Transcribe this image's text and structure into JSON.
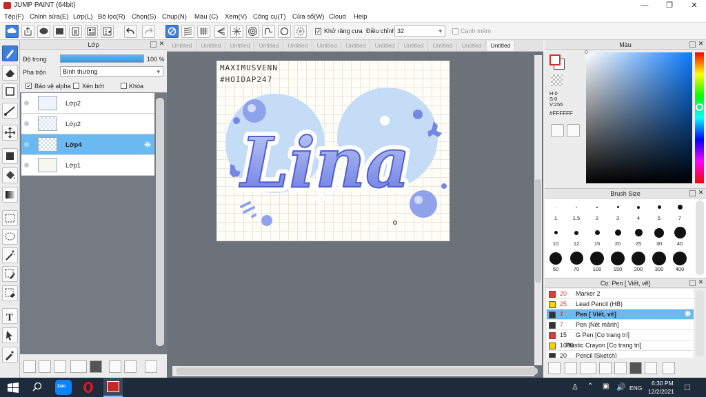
{
  "window": {
    "title": "JUMP PAINT (64bit)"
  },
  "menu": [
    "Tệp(F)",
    "Chỉnh sửa(E)",
    "Lớp(L)",
    "Bộ lọc(R)",
    "Chọn(S)",
    "Chụp(N)",
    "Màu (C)",
    "Xem(V)",
    "Công cụ(T)",
    "Cửa sổ(W)",
    "Cloud",
    "Help"
  ],
  "toolbar": {
    "antialias_label": "Khử răng cưa",
    "adjust_label": "Điều chỉnh",
    "adjust_value": "32",
    "snap_label": "Cạnh mềm"
  },
  "layer_panel": {
    "title": "Lớp",
    "opacity_label": "Độ trong",
    "opacity_value": "100 %",
    "opacity_level": 1.0,
    "blend_label": "Pha trộn",
    "blend_value": "Bình thường",
    "protect_alpha": "Bảo vệ alpha",
    "clip": "Xén bớt",
    "lock": "Khóa",
    "layers": [
      {
        "name": "Lớp2",
        "selected": false
      },
      {
        "name": "Lớp2",
        "selected": false
      },
      {
        "name": "Lớp4",
        "selected": true
      },
      {
        "name": "Lớp1",
        "selected": false
      }
    ]
  },
  "tabs": [
    "Untitled",
    "Untitled",
    "Untitled",
    "Untitled",
    "Untitled",
    "Untitled",
    "Untitled",
    "Untitled",
    "Untitled",
    "Untitled",
    "Untitled",
    "Untitled"
  ],
  "artwork": {
    "signature_line1": "MAXIMUSVENN",
    "signature_line2": "#HOIDAP247",
    "lettering": "Lina"
  },
  "color_panel": {
    "title": "Màu",
    "h": "H:0",
    "s": "S:0",
    "v": "V:255",
    "hex": "#FFFFFF"
  },
  "brush_size_panel": {
    "title": "Brush Size",
    "sizes": [
      "1",
      "1.5",
      "2",
      "3",
      "4",
      "5",
      "7",
      "10",
      "12",
      "15",
      "20",
      "25",
      "30",
      "40",
      "50",
      "70",
      "100",
      "150",
      "200",
      "300",
      "400"
    ]
  },
  "brush_list_panel": {
    "title": "Cọ: Pen [ Viết, vẽ]",
    "brushes": [
      {
        "size": "20",
        "name": "Marker 2",
        "color": "#e53935",
        "selected": false
      },
      {
        "size": "25",
        "name": "Lead Pencil (HB)",
        "color": "#f5d20a",
        "selected": false
      },
      {
        "size": "7",
        "name": "Pen [ Viết, vẽ]",
        "color": "#333333",
        "selected": true
      },
      {
        "size": "7",
        "name": "Pen [Nét mảnh]",
        "color": "#333333",
        "selected": false
      },
      {
        "size": "15",
        "name": "G Pen [Cọ trang trí]",
        "color": "#e53935",
        "selected": false
      },
      {
        "size": "1000",
        "name": "Plastic Crayon [Cọ trang trí]",
        "color": "#f5d20a",
        "selected": false
      },
      {
        "size": "20",
        "name": "Pencil [Sketch]",
        "color": "#333333",
        "selected": false
      }
    ]
  },
  "taskbar": {
    "language": "ENG",
    "time": "6:30 PM",
    "date": "12/2/2021",
    "zalo_label": "Zalo"
  }
}
